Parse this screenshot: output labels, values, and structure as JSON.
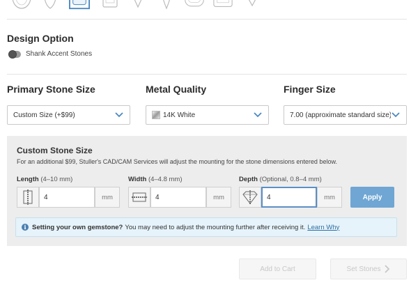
{
  "shapes": [
    "round-shape-icon",
    "pear-shape-icon",
    "cushion-shape-icon",
    "emerald-shape-icon",
    "heart-shape-icon",
    "marquise-shape-icon",
    "oval-shape-icon",
    "radiant-shape-icon",
    "trillion-shape-icon"
  ],
  "design_option": {
    "title": "Design Option",
    "toggle_label": "Shank Accent Stones"
  },
  "selects": {
    "stone_size": {
      "label": "Primary Stone Size",
      "value": "Custom Size (+$99)"
    },
    "metal": {
      "label": "Metal Quality",
      "value": "14K White"
    },
    "finger": {
      "label": "Finger Size",
      "value": "7.00 (approximate standard size)"
    }
  },
  "custom": {
    "title": "Custom Stone Size",
    "description": "For an additional $99, Stuller's CAD/CAM Services will adjust the mounting for the stone dimensions entered below.",
    "length": {
      "label": "Length",
      "hint": "(4–10 mm)",
      "value": "4",
      "unit": "mm"
    },
    "width": {
      "label": "Width",
      "hint": "(4–4.8 mm)",
      "value": "4",
      "unit": "mm"
    },
    "depth": {
      "label": "Depth",
      "hint": "(Optional, 0.8–4 mm)",
      "value": "4",
      "unit": "mm"
    },
    "apply_label": "Apply"
  },
  "info": {
    "bold": "Setting your own gemstone?",
    "text": "You may need to adjust the mounting further after receiving it.",
    "link": "Learn Why"
  },
  "actions": {
    "add_to_cart": "Add to Cart",
    "set_stones": "Set Stones"
  },
  "colors": {
    "accent": "#6fa6d3",
    "focus": "#5a8fc6",
    "link": "#2d6ea3",
    "info_bg": "#e6f3fa",
    "panel_bg": "#ededed"
  }
}
